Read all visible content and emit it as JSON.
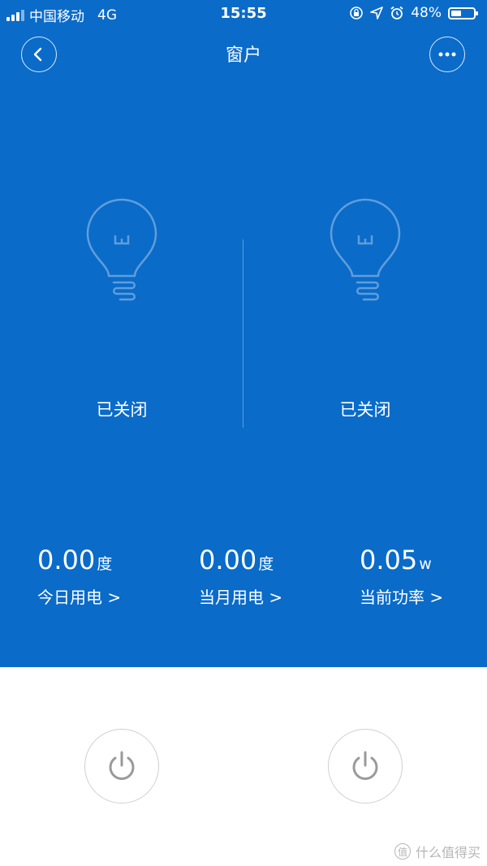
{
  "status_bar": {
    "carrier": "中国移动",
    "network": "4G",
    "time": "15:55",
    "battery": "48%",
    "battery_level": 0.48
  },
  "header": {
    "title": "窗户"
  },
  "switches": [
    {
      "state": "已关闭"
    },
    {
      "state": "已关闭"
    }
  ],
  "stats": [
    {
      "value": "0.00",
      "unit": "度",
      "label": "今日用电 >"
    },
    {
      "value": "0.00",
      "unit": "度",
      "label": "当月用电 >"
    },
    {
      "value": "0.05",
      "unit": "w",
      "label": "当前功率 >"
    }
  ],
  "watermark": {
    "text": "什么值得买",
    "badge": "值"
  },
  "colors": {
    "primary": "#0a6bc9",
    "icon_outline": "rgba(255,255,255,0.35)"
  },
  "icons": [
    "back-icon",
    "more-icon",
    "lightbulb-icon",
    "power-icon"
  ]
}
